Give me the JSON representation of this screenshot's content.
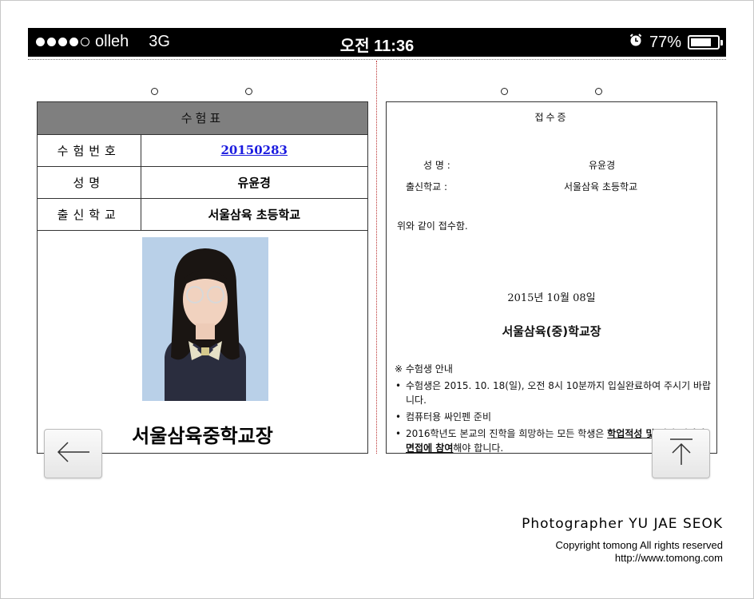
{
  "status_bar": {
    "carrier": "olleh",
    "network": "3G",
    "time": "오전 11:36",
    "battery": "77%",
    "battery_level": 0.77,
    "signal_bars_filled": 4,
    "signal_bars_total": 5,
    "alarm_icon": "alarm-clock-icon"
  },
  "admission_card": {
    "title": "수험표",
    "rows": [
      {
        "label": "수험번호",
        "value": "20150283"
      },
      {
        "label": "성명",
        "value": "유윤경"
      },
      {
        "label": "출신학교",
        "value": "서울삼육 초등학교"
      }
    ],
    "principal": "서울삼육중학교장"
  },
  "receipt_card": {
    "title": "접수증",
    "name_label": "성 명 :",
    "name_value": "유윤경",
    "school_label": "출신학교 :",
    "school_value": "서울삼육 초등학교",
    "statement": "위와 같이 접수함.",
    "date": "2015년 10월 08일",
    "school_sign": "서울삼육(중)학교장",
    "notice_heading": "※ 수험생 안내",
    "notice_items": [
      "수험생은 2015. 10. 18(일), 오전 8시 10분까지 입실완료하여 주시기 바랍니다.",
      "컴퓨터용 싸인펜 준비"
    ],
    "notice_item3_before": "2016학년도 본교의 진학을 희망하는 모든 학생은 ",
    "notice_item3_u1": "학업적성 및 역량 검사와 면접에 참여",
    "notice_item3_after": "해야 합니다."
  },
  "nav": {
    "back_icon": "left-arrow-icon",
    "top_icon": "scroll-to-top-icon"
  },
  "credits": {
    "photographer": "Photographer YU JAE SEOK",
    "copyright": "Copyright tomong All rights reserved",
    "url": "http://www.tomong.com"
  }
}
